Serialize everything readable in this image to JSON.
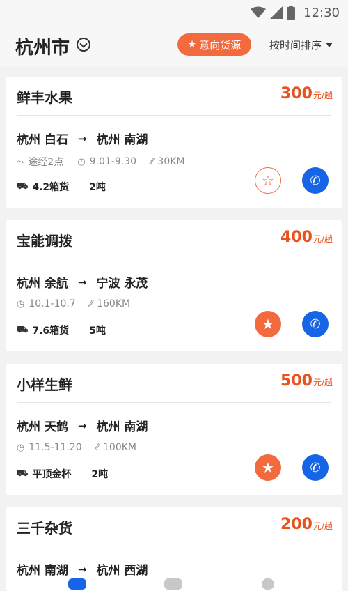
{
  "status_bar": {
    "time": "12:30",
    "icons": [
      "wifi-icon",
      "signal-icon",
      "battery-icon"
    ]
  },
  "header": {
    "city": "杭州市",
    "city_icon": "chevron-down-circle-icon",
    "intent_button": {
      "icon": "star-icon",
      "label": "意向货源"
    },
    "sort_label": "按时间排序",
    "sort_icon": "triangle-down-icon"
  },
  "colors": {
    "accent": "#f36a3e",
    "price": "#e8521f",
    "call": "#1565e6"
  },
  "cards": [
    {
      "title": "鲜丰水果",
      "price": "300",
      "price_unit": "元/趟",
      "from": "杭州 白石",
      "arrow": "→",
      "to": "杭州 南湖",
      "via": "途经2点",
      "date": "9.01-9.30",
      "distance": "30KM",
      "vehicle": "4.2箱货",
      "weight": "2吨",
      "favorited": false
    },
    {
      "title": "宝能调拨",
      "price": "400",
      "price_unit": "元/趟",
      "from": "杭州 余航",
      "arrow": "→",
      "to": "宁波 永茂",
      "date": "10.1-10.7",
      "distance": "160KM",
      "vehicle": "7.6箱货",
      "weight": "5吨",
      "favorited": true
    },
    {
      "title": "小样生鲜",
      "price": "500",
      "price_unit": "元/趟",
      "from": "杭州 天鹤",
      "arrow": "→",
      "to": "杭州 南湖",
      "date": "11.5-11.20",
      "distance": "100KM",
      "vehicle": "平顶金杯",
      "weight": "2吨",
      "favorited": true
    },
    {
      "title": "三千杂货",
      "price": "200",
      "price_unit": "元/趟",
      "from": "杭州 南湖",
      "arrow": "→",
      "to": "杭州 西湖"
    }
  ]
}
